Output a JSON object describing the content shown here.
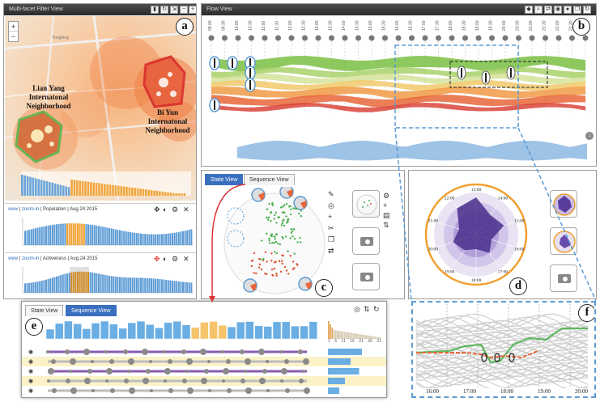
{
  "panel_a": {
    "title": "Multi-facet Filter View",
    "badge": "a",
    "zoom_in": "+",
    "zoom_out": "−",
    "map_town": "Yongfeng",
    "neighborhood_left": "Lian Yang Internatonal Neighborhood",
    "neighborhood_right": "Bi Yun Internatonal Neighborhood",
    "facet1": {
      "view": "view",
      "zoom": "zoom-in",
      "meta": "Population | Aug.24 2015"
    },
    "facet2": {
      "view": "view",
      "zoom": "zoom-in",
      "meta": "Activeness | Aug.24 2015"
    }
  },
  "panel_b": {
    "title": "Flow View",
    "badge": "b",
    "times": [
      "09:00",
      "09:30",
      "10:00",
      "10:30",
      "11:00",
      "11:30",
      "12:00",
      "12:30",
      "13:00",
      "13:30",
      "14:00",
      "14:30",
      "15:00",
      "15:30",
      "16:00",
      "16:30",
      "17:00",
      "17:30",
      "18:00",
      "18:30",
      "19:00",
      "19:30",
      "20:00",
      "20:30",
      "21:00",
      "21:30",
      "22:00",
      "22:30",
      "23:00"
    ]
  },
  "panel_c": {
    "badge": "c",
    "tab_state": "State View",
    "tab_sequence": "Sequence View"
  },
  "panel_d": {
    "badge": "d",
    "clock_labels": [
      "13:00",
      "14:00",
      "15:00",
      "16:00",
      "17:00",
      "18:00",
      "19:00",
      "20:00",
      "21:00",
      "22:00"
    ]
  },
  "panel_e": {
    "badge": "e",
    "tab_state": "State View",
    "tab_sequence": "Sequence View",
    "hist_ticks": [
      "1",
      "6",
      "11",
      "16",
      "21",
      "26",
      "31"
    ]
  },
  "panel_f": {
    "badge": "f",
    "times": [
      "16:00",
      "17:00",
      "18:00",
      "19:00",
      "20:00"
    ]
  },
  "colors": {
    "blue": "#5b9bd5",
    "orange": "#f0a030",
    "purple": "#8a5db0",
    "green": "#4caf50",
    "red": "#e05030"
  }
}
